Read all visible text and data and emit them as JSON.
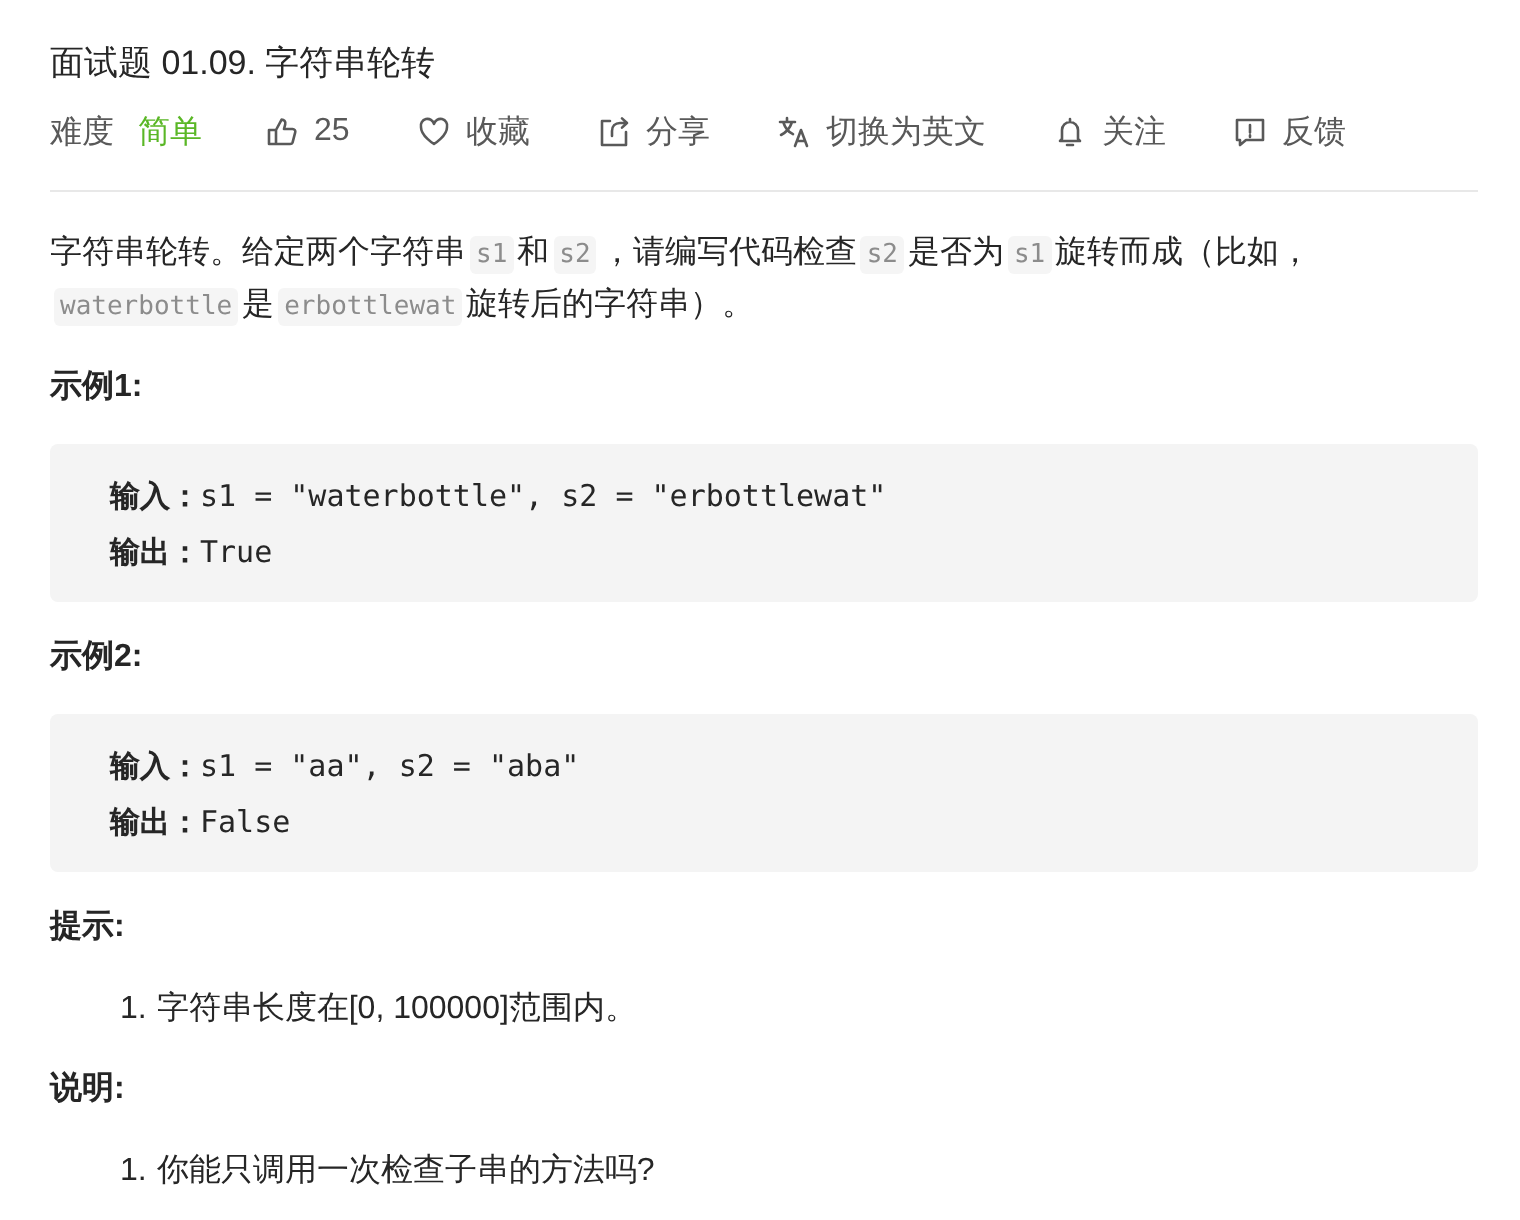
{
  "title": "面试题 01.09. 字符串轮转",
  "meta": {
    "difficulty": {
      "label": "难度",
      "value": "简单",
      "kind": "easy"
    },
    "actions": [
      {
        "kind": "like",
        "label": "25"
      },
      {
        "kind": "favorite",
        "label": "收藏"
      },
      {
        "kind": "share",
        "label": "分享"
      },
      {
        "kind": "translate",
        "label": "切换为英文"
      },
      {
        "kind": "follow",
        "label": "关注"
      },
      {
        "kind": "feedback",
        "label": "反馈"
      }
    ]
  },
  "description": [
    {
      "kind": "text",
      "text": "字符串轮转。给定两个字符串"
    },
    {
      "kind": "code",
      "text": "s1"
    },
    {
      "kind": "text",
      "text": "和"
    },
    {
      "kind": "code",
      "text": "s2"
    },
    {
      "kind": "text",
      "text": "，请编写代码检查"
    },
    {
      "kind": "code",
      "text": "s2"
    },
    {
      "kind": "text",
      "text": "是否为"
    },
    {
      "kind": "code",
      "text": "s1"
    },
    {
      "kind": "text",
      "text": "旋转而成（比如，"
    },
    {
      "kind": "code",
      "text": "waterbottle"
    },
    {
      "kind": "text",
      "text": "是"
    },
    {
      "kind": "code",
      "text": "erbottlewat"
    },
    {
      "kind": "text",
      "text": "旋转后的字符串）。"
    }
  ],
  "sections": [
    {
      "kind": "example",
      "heading": "示例1:",
      "lines": [
        "**输入：**s1 = \"waterbottle\", s2 = \"erbottlewat\"",
        "**输出：**True"
      ]
    },
    {
      "kind": "example",
      "heading": "示例2:",
      "lines": [
        "**输入：**s1 = \"aa\", s2 = \"aba\"",
        "**输出：**False"
      ]
    },
    {
      "kind": "list",
      "heading": "提示:",
      "items": [
        {
          "number": "1.",
          "text": "字符串长度在[0, 100000]范围内。"
        }
      ]
    },
    {
      "kind": "list",
      "heading": "说明:",
      "items": [
        {
          "number": "1.",
          "text": "你能只调用一次检查子串的方法吗?"
        }
      ]
    }
  ]
}
